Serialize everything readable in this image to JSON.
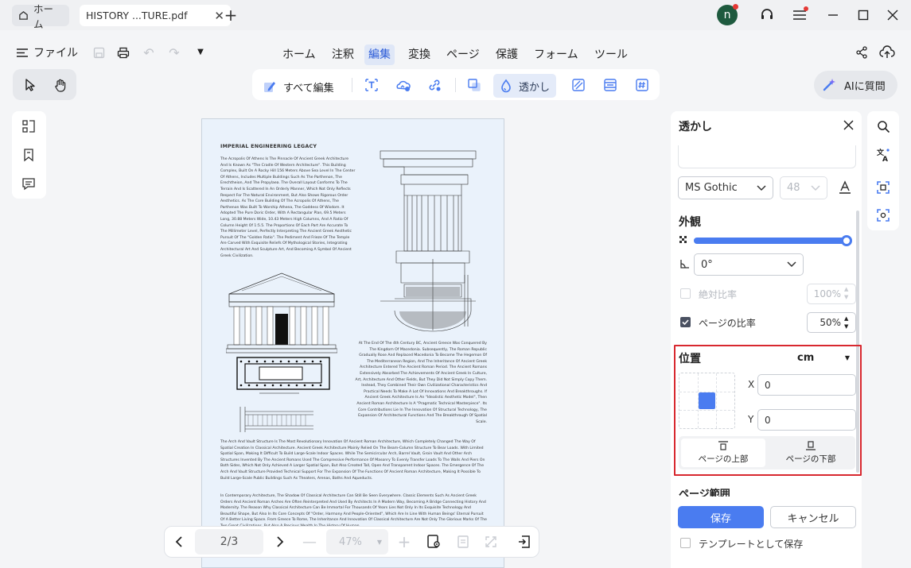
{
  "tabs": [
    {
      "label": "ホーム"
    },
    {
      "label": "HISTORY ...TURE.pdf"
    }
  ],
  "user": {
    "initial": "n"
  },
  "menu": {
    "file_label": "ファイル",
    "items": [
      "ホーム",
      "注釈",
      "編集",
      "変換",
      "ページ",
      "保護",
      "フォーム",
      "ツール"
    ],
    "active": "編集"
  },
  "toolbar": {
    "edit_all": "すべて編集",
    "watermark": "透かし",
    "ai": "AIに質問"
  },
  "document": {
    "heading": "IMPERIAL ENGINEERING LEGACY",
    "para1": "The Acropolis Of Athens Is The Pinnacle Of Ancient Greek Architecture And Is Known As \"The Cradle Of Western Architecture\". This Building Complex, Built On A Rocky Hill 156 Meters Above Sea Level In The Center Of Athens, Includes Multiple Buildings Such As The Parthenon, The Erechtheion, And The Propylaea. The Overall Layout Conforms To The Terrain And Is Scattered In An Orderly Manner, Which Not Only Reflects Respect For The Natural Environment, But Also Shows Rigorous Order Aesthetics. As The Core Building Of The Acropolis Of Athens, The Parthenon Was Built To Worship Athena, The Goddess Of Wisdom. It Adopted The Pure Doric Order, With A Rectangular Plan, 69.5 Meters Long, 30.88 Meters Wide, 10.43 Meters High Columns, And A Ratio Of Column Height Of 1:5.5. The Proportions Of Each Part Are Accurate To The Millimeter Level, Perfectly Interpreting The Ancient Greek Aesthetic Pursuit Of The \"Golden Ratio\". The Pediment And Frieze Of The Temple Are Carved With Exquisite Reliefs Of Mythological Stories, Integrating Architectural Art And Sculpture Art, And Becoming A Symbol Of Ancient Greek Civilization.",
    "para2": "At The End Of The 4th Century BC, Ancient Greece Was Conquered By The Kingdom Of Macedonia. Subsequently, The Roman Republic Gradually Rose And Replaced Macedonia To Become The Hegemon Of The Mediterranean Region, And The Inheritance Of Ancient Greek Architecture Entered The Ancient Roman Period. The Ancient Romans Extensively Absorbed The Achievements Of Ancient Greek In Culture, Art, Architecture And Other Fields, But They Did Not Simply Copy Them. Instead, They Combined Their Own Civilizational Characteristics And Practical Needs To Make A Lot Of Innovations And Breakthroughs. If Ancient Greek Architecture Is An \"Idealistic Aesthetic Model\", Then Ancient Roman Architecture Is A \"Pragmatic Technical Masterpiece\". Its Core Contributions Lie In The Innovation Of Structural Technology, The Expansion Of Architectural Functions And The Breakthrough Of Spatial Scale.",
    "para3": "The Arch And Vault Structure Is The Most Revolutionary Innovation Of Ancient Roman Architecture, Which Completely Changed The Way Of Spatial Creation In Classical Architecture. Ancient Greek Architecture Mainly Relied On The Beam-Column Structure To Bear Loads. With Limited Spatial Span, Making It Difficult To Build Large-Scale Indoor Spaces. While The Semicircular Arch, Barrel Vault, Groin Vault And Other Arch Structures Invented By The Ancient Romans Used The Compressive Performance Of Masonry To Evenly Transfer Loads To The Walls And Piers On Both Sides, Which Not Only Achieved A Larger Spatial Span, But Also Created Tall, Open And Transparent Indoor Spaces. The Emergence Of The Arch And Vault Structure Provided Technical Support For The Expansion Of The Functions Of Ancient Roman Architecture, Making It Possible To Build Large-Scale Public Buildings Such As Theaters, Arenas, Baths And Aqueducts.",
    "para4": "In Contemporary Architecture, The Shadow Of Classical Architecture Can Still Be Seen Everywhere. Classic Elements Such As Ancient Greek Orders And Ancient Roman Arches Are Often Reinterpreted And Used By Architects In A Modern Way, Becoming A Bridge Connecting History And Modernity. The Reason Why Classical Architecture Can Be Immortal For Thousands Of Years Lies Not Only In Its Exquisite Technology And Beautiful Shape, But Also In Its Core Concepts Of \"Order, Harmony And People-Oriented\", Which Are In Line With Human Beings' Eternal Pursuit Of A Better Living Space. From Greece To Rome, The Inheritance And Innovation Of Classical Architecture Are Not Only The Glorious Marks Of The Two Great Civilizations, But Also A Precious Wealth In The History Of Human"
  },
  "nav": {
    "page": "2/3",
    "zoom": "47%"
  },
  "panel": {
    "title": "透かし",
    "font": "MS Gothic",
    "font_size": "48",
    "appearance": "外観",
    "opacity": 1.0,
    "rotation": "0°",
    "absolute_ratio": "絶対比率",
    "absolute_value": "100%",
    "page_ratio": "ページの比率",
    "page_ratio_value": "50%",
    "position": "位置",
    "unit": "cm",
    "x_label": "X",
    "x_value": "0",
    "y_label": "Y",
    "y_value": "0",
    "top_of_page": "ページの上部",
    "bottom_of_page": "ページの下部",
    "page_range": "ページ範囲",
    "save": "保存",
    "cancel": "キャンセル",
    "save_template": "テンプレートとして保存"
  },
  "colors": {
    "accent": "#4a7cf0",
    "highlight": "#d8282f"
  }
}
